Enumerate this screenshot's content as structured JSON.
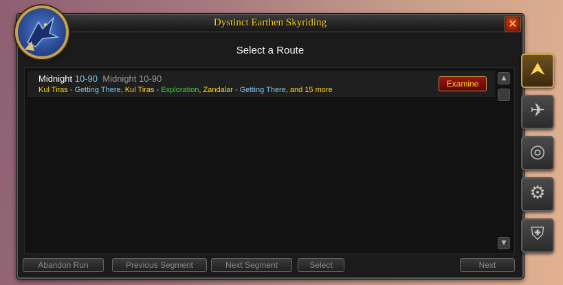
{
  "window": {
    "title": "Dystinct Earthen Skyriding",
    "close_label": "✕",
    "subtitle": "Select a Route"
  },
  "portrait": {
    "icon": "blue-dragon-portrait-icon"
  },
  "route": {
    "name": "Midnight",
    "level": "10-90",
    "alt_name": "Midnight 10-90",
    "zones": [
      {
        "zone": "Kul Tiras",
        "sep": " - ",
        "activity": "Getting There",
        "after": ", "
      },
      {
        "zone": "Kul Tiras",
        "sep": " - ",
        "activity": "Exploration",
        "after": ", "
      },
      {
        "zone": "Zandalar",
        "sep": " - ",
        "activity": "Getting There",
        "after": ", "
      }
    ],
    "more": "and 15 more",
    "examine_label": "Examine"
  },
  "buttons": {
    "abandon": "Abandon Run",
    "previous": "Previous Segment",
    "next_segment": "Next Segment",
    "select": "Select",
    "next": "Next"
  },
  "side_tabs": [
    {
      "icon": "chevron-up-arrow-icon",
      "glyph": "⮝"
    },
    {
      "icon": "map-scroll-icon",
      "glyph": "✈"
    },
    {
      "icon": "compass-icon",
      "glyph": "◎"
    },
    {
      "icon": "gear-icon",
      "glyph": "⚙"
    },
    {
      "icon": "armor-icon",
      "glyph": "⛨"
    }
  ],
  "colors": {
    "title_gold": "#ffd21a",
    "level_blue": "#7ec8ea",
    "exploration_green": "#35d335",
    "examine_red": "#9d1414"
  }
}
